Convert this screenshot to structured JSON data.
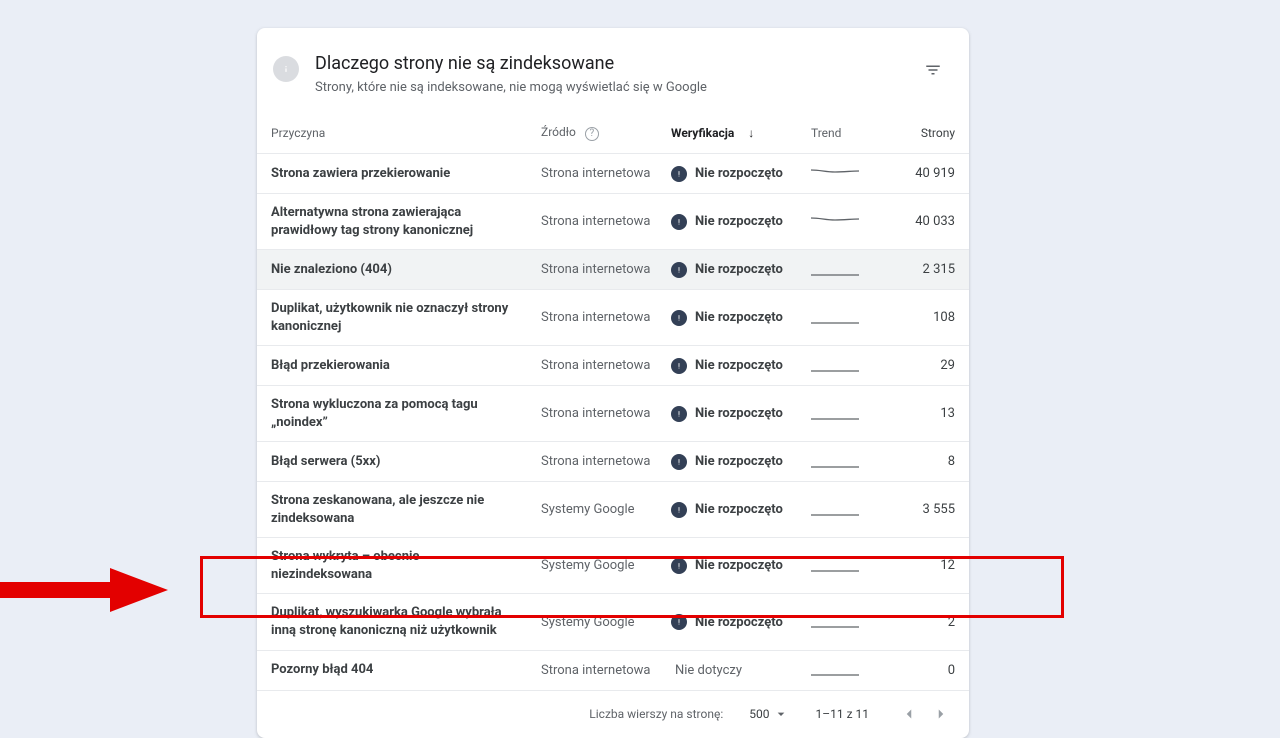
{
  "header": {
    "title": "Dlaczego strony nie są zindeksowane",
    "subtitle": "Strony, które nie są indeksowane, nie mogą wyświetlać się w Google"
  },
  "columns": {
    "reason": "Przyczyna",
    "source": "Źródło",
    "verify": "Weryfikacja",
    "trend": "Trend",
    "pages": "Strony"
  },
  "status_not_started": "Nie rozpoczęto",
  "status_na": "Nie dotyczy",
  "rows": [
    {
      "reason": "Strona zawiera przekierowanie",
      "source": "Strona internetowa",
      "status": "ns",
      "spark": "flat-high",
      "pages": "40 919"
    },
    {
      "reason": "Alternatywna strona zawierająca prawidłowy tag strony kanonicznej",
      "source": "Strona internetowa",
      "status": "ns",
      "spark": "flat-high",
      "pages": "40 033"
    },
    {
      "reason": "Nie znaleziono (404)",
      "source": "Strona internetowa",
      "status": "ns",
      "spark": "flat-low",
      "pages": "2 315",
      "hovered": true
    },
    {
      "reason": "Duplikat, użytkownik nie oznaczył strony kanonicznej",
      "source": "Strona internetowa",
      "status": "ns",
      "spark": "flat-low",
      "pages": "108"
    },
    {
      "reason": "Błąd przekierowania",
      "source": "Strona internetowa",
      "status": "ns",
      "spark": "flat-low",
      "pages": "29"
    },
    {
      "reason": "Strona wykluczona za pomocą tagu „noindex”",
      "source": "Strona internetowa",
      "status": "ns",
      "spark": "flat-low",
      "pages": "13"
    },
    {
      "reason": "Błąd serwera (5xx)",
      "source": "Strona internetowa",
      "status": "ns",
      "spark": "flat-low",
      "pages": "8"
    },
    {
      "reason": "Strona zeskanowana, ale jeszcze nie zindeksowana",
      "source": "Systemy Google",
      "status": "ns",
      "spark": "flat-low",
      "pages": "3 555"
    },
    {
      "reason": "Strona wykryta – obecnie niezindeksowana",
      "source": "Systemy Google",
      "status": "ns",
      "spark": "flat-low",
      "pages": "12"
    },
    {
      "reason": "Duplikat, wyszukiwarka Google wybrała inną stronę kanoniczną niż użytkownik",
      "source": "Systemy Google",
      "status": "ns",
      "spark": "flat-low",
      "pages": "2",
      "highlight": true
    },
    {
      "reason": "Pozorny błąd 404",
      "source": "Strona internetowa",
      "status": "na",
      "spark": "flat-low",
      "pages": "0"
    }
  ],
  "footer": {
    "rows_label": "Liczba wierszy na stronę:",
    "rows_value": "500",
    "range": "1–11 z 11"
  }
}
